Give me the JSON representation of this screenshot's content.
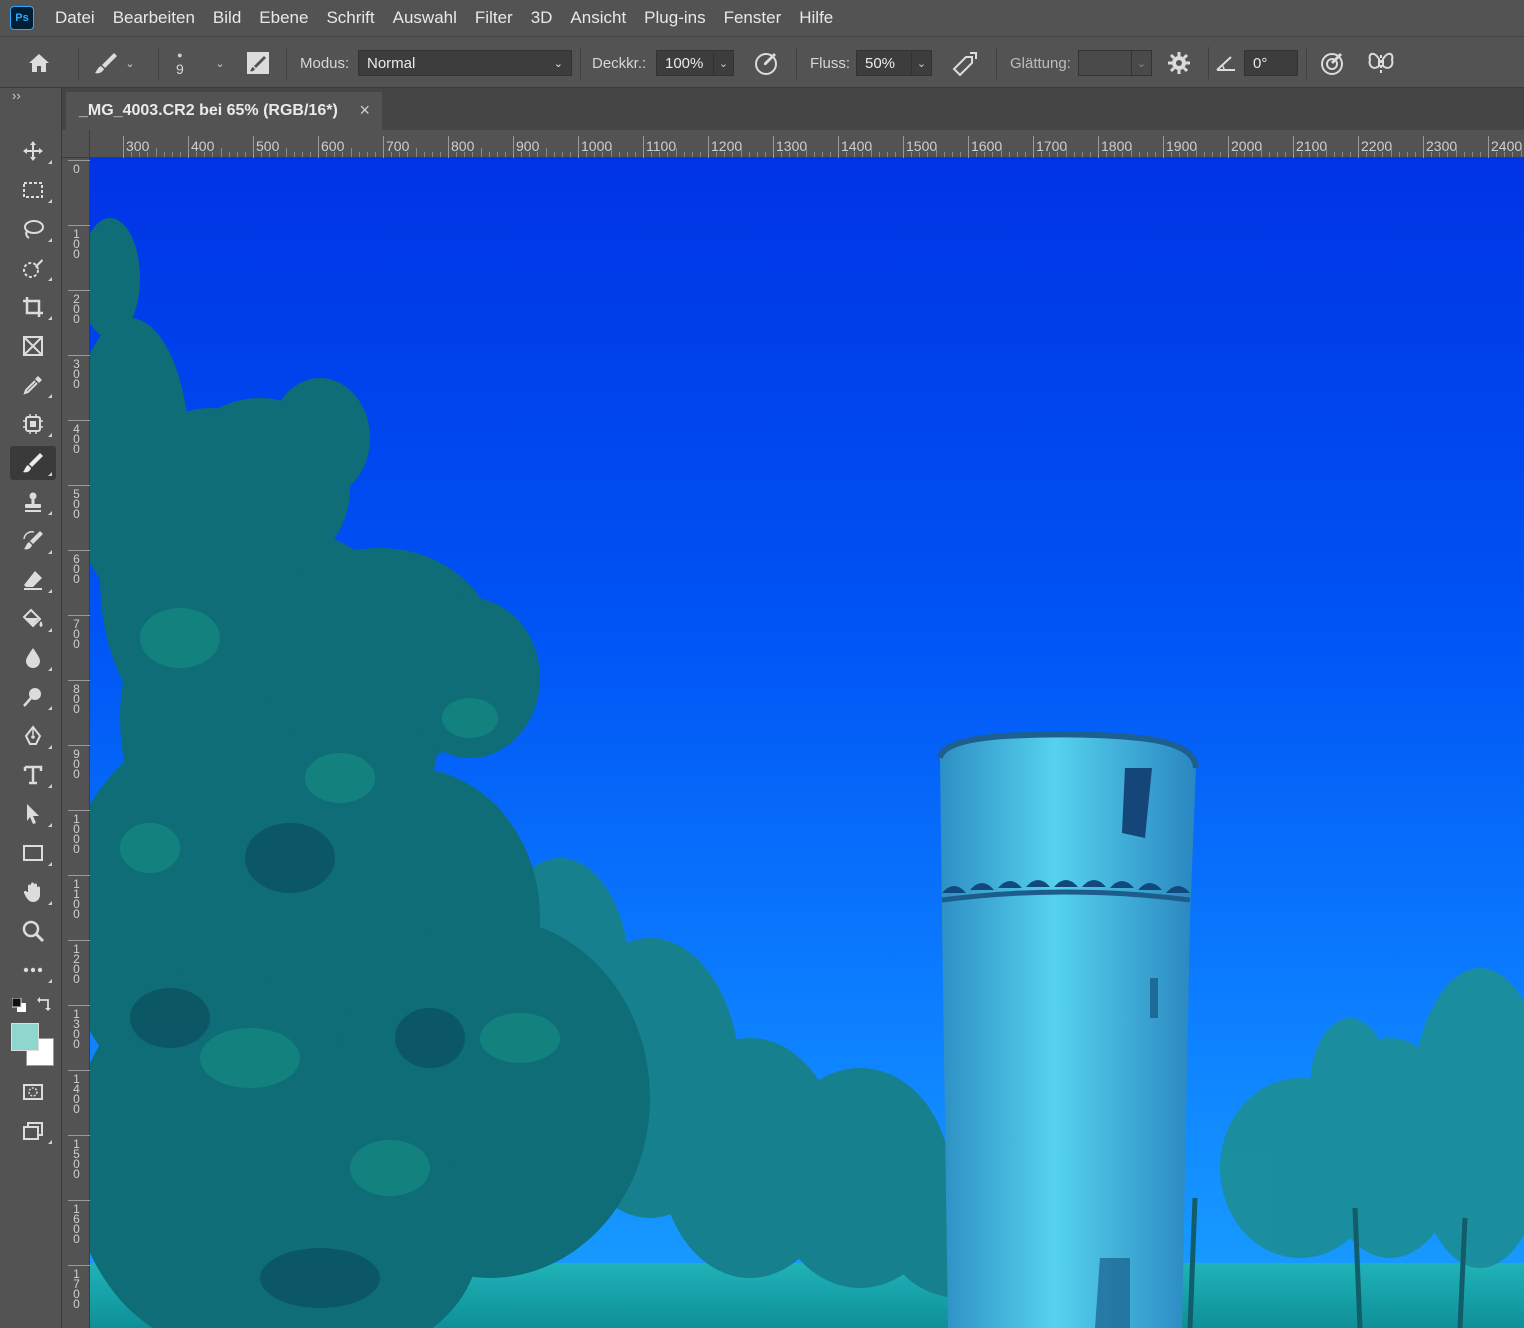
{
  "app": {
    "logo_text": "Ps"
  },
  "menu": {
    "items": [
      "Datei",
      "Bearbeiten",
      "Bild",
      "Ebene",
      "Schrift",
      "Auswahl",
      "Filter",
      "3D",
      "Ansicht",
      "Plug-ins",
      "Fenster",
      "Hilfe"
    ]
  },
  "options": {
    "brush_size": "9",
    "mode_label": "Modus:",
    "mode_value": "Normal",
    "opacity_label": "Deckkr.:",
    "opacity_value": "100%",
    "flow_label": "Fluss:",
    "flow_value": "50%",
    "smoothing_label": "Glättung:",
    "smoothing_value": "",
    "angle_value": "0°"
  },
  "document": {
    "tab_title": "_MG_4003.CR2 bei 65% (RGB/16*)",
    "close_glyph": "×"
  },
  "tools": {
    "collapse_glyph": "››",
    "active": "brush",
    "foreground_color": "#8fd6cf",
    "background_color": "#ffffff"
  },
  "rulers": {
    "horizontal": [
      "300",
      "400",
      "500",
      "600",
      "700",
      "800",
      "900",
      "1000",
      "1100",
      "1200",
      "1300",
      "1400",
      "1500",
      "1600",
      "1700",
      "1800",
      "1900",
      "2000",
      "2100",
      "2200",
      "2300",
      "2400"
    ],
    "vertical": [
      "0",
      "100",
      "200",
      "300",
      "400",
      "500",
      "600",
      "700",
      "800",
      "900",
      "1000",
      "1100",
      "1200",
      "1300",
      "1400",
      "1500",
      "1600",
      "1700"
    ]
  },
  "colors": {
    "ui_bg": "#535353",
    "sky_top": "#0033e6",
    "sky_bottom": "#1aa0ff",
    "foliage": "#0f6f7a",
    "tower": "#3bb8d8"
  }
}
